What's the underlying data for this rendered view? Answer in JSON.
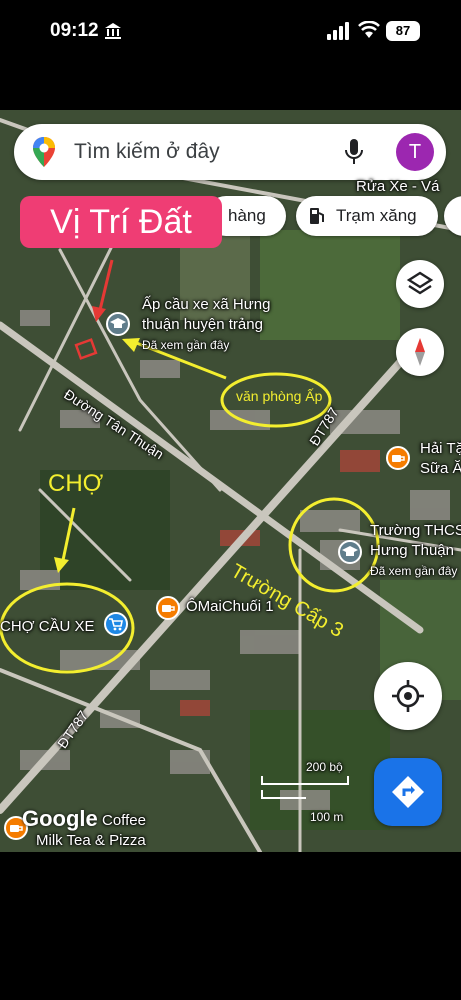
{
  "status_bar": {
    "time": "09:12",
    "battery": "87"
  },
  "search": {
    "placeholder": "Tìm kiếm ở đây",
    "avatar_letter": "T"
  },
  "chips": {
    "shopping_partial": "hàng",
    "gas_station": "Trạm xăng"
  },
  "annotations": {
    "land_location": "Vị Trí Đất",
    "hamlet_office": "văn phòng Ấp",
    "market": "CHỢ",
    "high_school": "Trường Cấp 3"
  },
  "map_labels": {
    "car_wash": "Rửa Xe - Vá",
    "hamlet_office_name_1": "Ấp cầu xe xã Hưng",
    "hamlet_office_name_2": "thuận huyện trảng",
    "seen_recently": "Đã xem gần đây",
    "tan_thuan_road": "Đường Tân Thuận",
    "dt787_north": "ĐT787",
    "dt787_south": "ĐT787",
    "hai_tac_1": "Hải Tặ",
    "hai_tac_2": "Sữa Ă",
    "school_1": "Trường THCS",
    "school_2": "Hưng Thuận",
    "school_seen": "Đã xem gần đây",
    "omai": "ÔMaiChuối 1",
    "market_name": "CHỢ CẦU XE",
    "coffee": "Coffee",
    "milk_tea": "Milk Tea & Pizza",
    "google": "Google",
    "scale_ft": "200 bộ",
    "scale_m": "100 m"
  },
  "colors": {
    "annotation_yellow": "#f3ee2f",
    "annotation_pink": "#ef3d74",
    "marker_red": "#e53935",
    "directions_blue": "#1a73e8"
  },
  "icons": [
    "bank-icon",
    "signal-icon",
    "wifi-icon",
    "maps-pin-icon",
    "mic-icon",
    "gas-pump-icon",
    "layers-icon",
    "compass-icon",
    "locate-icon",
    "directions-icon",
    "school-icon",
    "cafe-icon",
    "shopping-cart-icon"
  ]
}
